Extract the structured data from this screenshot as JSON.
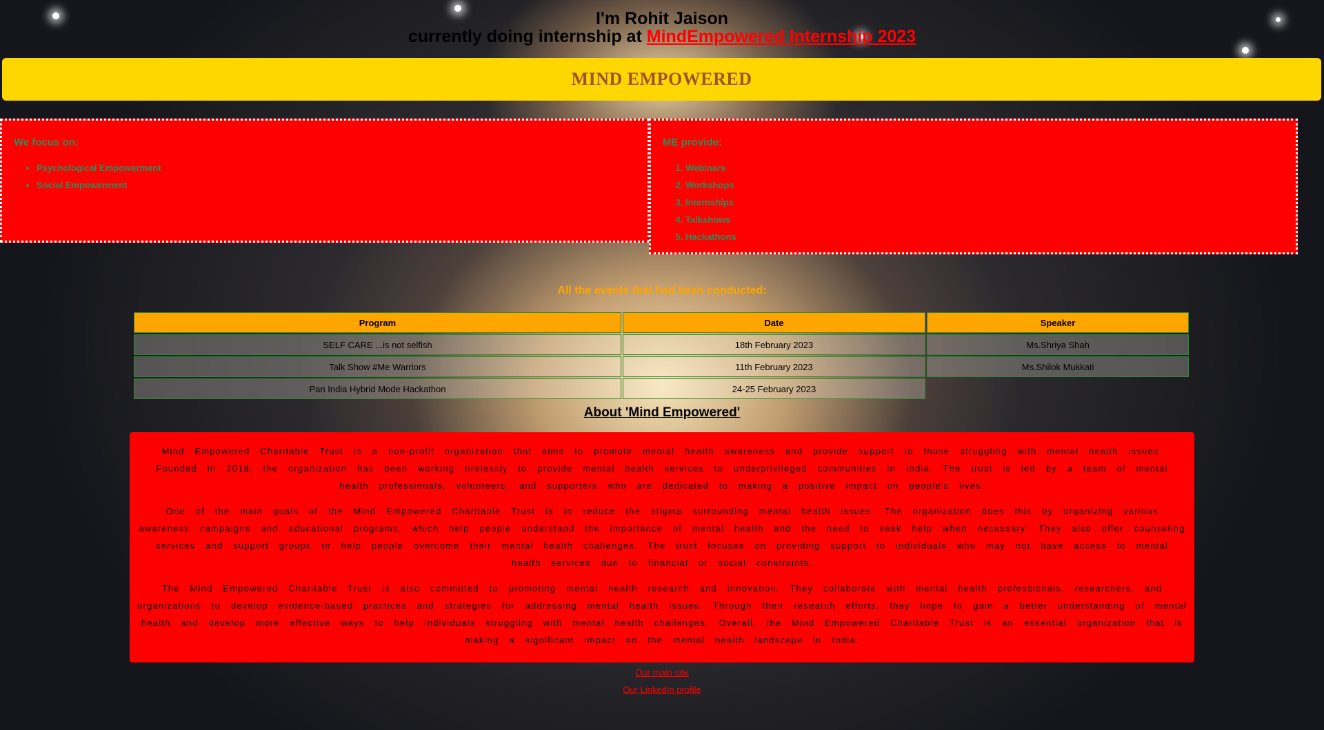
{
  "header": {
    "line1": "I'm Rohit Jaison",
    "line2_prefix": "currently doing internship at ",
    "link_text": "MindEmpowered Internship 2023"
  },
  "banner": {
    "title": "MIND EMPOWERED"
  },
  "focus": {
    "title": "We focus on:",
    "items": [
      "Psychological Empowerment",
      "Social Empowerment"
    ]
  },
  "provides": {
    "title": "ME provide:",
    "items": [
      "Webinars",
      "Workshops",
      "Internships",
      "Talkshows",
      "Hackathons"
    ]
  },
  "events": {
    "title": "All the events that had been conducted:",
    "headers": [
      "Program",
      "Date",
      "Speaker"
    ],
    "rows": [
      [
        "SELF CARE ...is not selfish",
        "18th February 2023",
        "Ms.Shriya Shah"
      ],
      [
        "Talk Show #Me Warriors",
        "11th February 2023",
        "Ms.Shilok Mukkati"
      ],
      [
        "Pan India Hybrid Mode Hackathon",
        "24-25 February 2023",
        ""
      ]
    ]
  },
  "about": {
    "title": "About 'Mind Empowered'",
    "paragraphs": [
      "Mind Empowered Charitable Trust is a non-profit organization that aims to promote mental health awareness and provide support to those struggling with mental health issues. Founded in 2018, the organization has been working tirelessly to provide mental health services to underprivileged communities in India. The trust is led by a team of mental health professionals, volunteers, and supporters who are dedicated to making a positive impact on people's lives.",
      "One of the main goals of the Mind Empowered Charitable Trust is to reduce the stigma surrounding mental health issues. The organization does this by organizing various awareness campaigns and educational programs, which help people understand the importance of mental health and the need to seek help when necessary. They also offer counseling services and support groups to help people overcome their mental health challenges. The trust focuses on providing support to individuals who may not have access to mental health services due to financial or social constraints.",
      "The Mind Empowered Charitable Trust is also committed to promoting mental health research and innovation. They collaborate with mental health professionals, researchers, and organizations to develop evidence-based practices and strategies for addressing mental health issues. Through their research efforts, they hope to gain a better understanding of mental health and develop more effective ways to help individuals struggling with mental health challenges. Overall, the Mind Empowered Charitable Trust is an essential organization that is making a significant impact on the mental health landscape in India."
    ]
  },
  "links": {
    "main_site": "Our main site",
    "linkedin": "Our LinkedIn profile"
  },
  "colors": {
    "banner": "#ffd700",
    "box": "#ff0000",
    "accent_orange": "#ffa500",
    "list_text": "#2e8b57"
  }
}
